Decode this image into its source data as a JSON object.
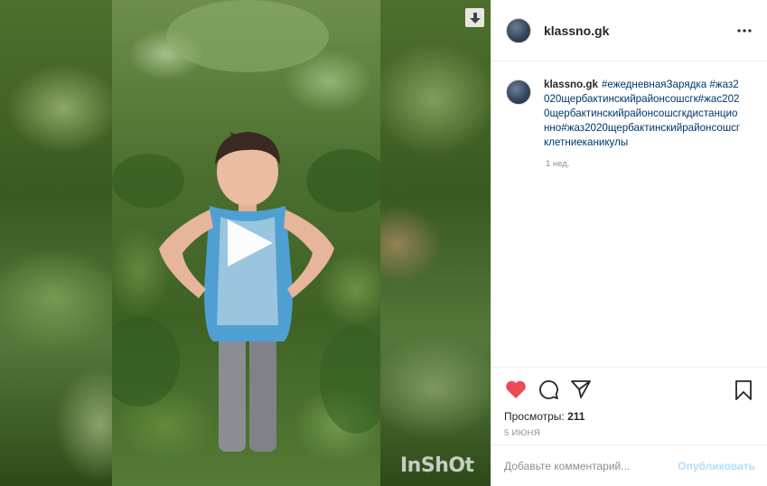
{
  "post": {
    "username": "klassno.gk",
    "caption_hashtags": "#ежедневнаяЗарядка #жаз2020щербактинскийрайонсошсгк#жас2020щербактинскийрайонсошсгкдистанционно#жаз2020щербактинскийрайонсошсгклетниеканикулы",
    "time_ago": "1 нед.",
    "views_label": "Просмотры:",
    "views_count": "211",
    "date": "5 ИЮНЯ"
  },
  "comment": {
    "placeholder": "Добавьте комментарий...",
    "post_label": "Опубликовать"
  },
  "video": {
    "watermark": "InShOt"
  },
  "icons": {
    "like": "heart-icon",
    "comment": "comment-bubble-icon",
    "share": "paper-plane-icon",
    "save": "bookmark-icon",
    "more": "more-options-icon",
    "play": "play-icon",
    "download": "download-arrow-icon"
  },
  "colors": {
    "like_red": "#ed4956",
    "link_blue": "#00376b",
    "post_disabled": "#b2dffc",
    "muted": "#8e8e8e"
  }
}
